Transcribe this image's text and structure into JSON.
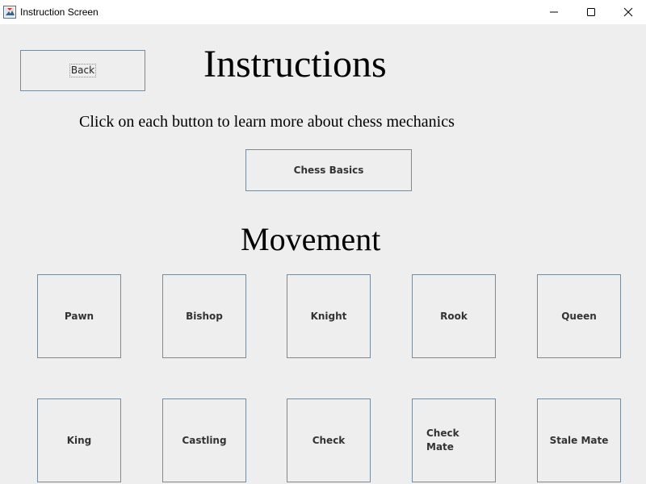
{
  "window": {
    "title": "Instruction Screen",
    "controls": [
      "minimize-icon",
      "maximize-icon",
      "close-icon"
    ]
  },
  "header": {
    "back_label": "Back",
    "title": "Instructions",
    "subtitle": "Click on each button to learn more about chess mechanics",
    "basics_label": "Chess Basics"
  },
  "movement": {
    "title": "Movement",
    "row1": [
      "Pawn",
      "Bishop",
      "Knight",
      "Rook",
      "Queen"
    ],
    "row2": [
      "King",
      "Castling",
      "Check",
      "Check Mate",
      "Stale Mate"
    ]
  }
}
